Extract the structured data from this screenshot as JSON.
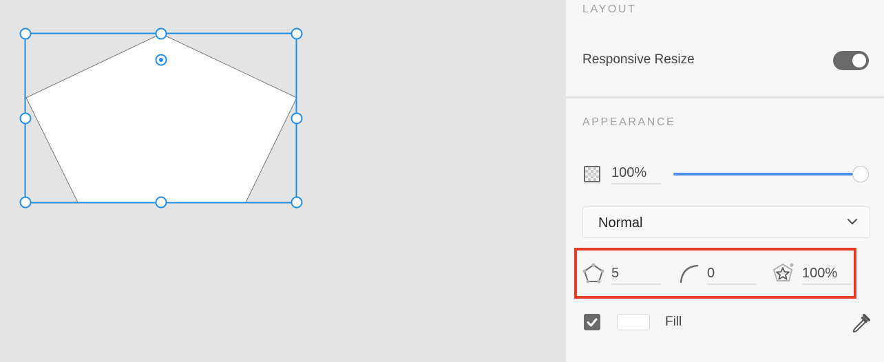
{
  "layout_section": {
    "title": "LAYOUT",
    "responsive_resize_label": "Responsive Resize",
    "responsive_resize_on": true
  },
  "appearance_section": {
    "title": "APPEARANCE",
    "opacity_value": "100%",
    "opacity_fraction": 1.0,
    "blend_mode": "Normal"
  },
  "polygon": {
    "corner_count": "5",
    "corner_radius": "0",
    "star_ratio": "100%"
  },
  "fill": {
    "enabled": true,
    "label": "Fill",
    "color": "#ffffff"
  },
  "colors": {
    "selection": "#1f8ee6",
    "highlight": "#e63d2b",
    "slider_fill": "#4e8ef0"
  }
}
